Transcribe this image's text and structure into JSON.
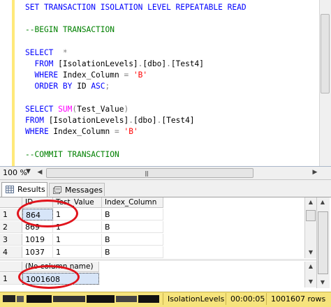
{
  "editor": {
    "lines": [
      {
        "parts": [
          {
            "t": "SET TRANSACTION ISOLATION LEVEL REPEATABLE READ",
            "c": "kw"
          }
        ]
      },
      {
        "parts": []
      },
      {
        "parts": [
          {
            "t": "--BEGIN TRANSACTION",
            "c": "cm"
          }
        ]
      },
      {
        "parts": []
      },
      {
        "parts": [
          {
            "t": "SELECT ",
            "c": "kw"
          },
          {
            "t": " *",
            "c": "gr"
          }
        ]
      },
      {
        "parts": [
          {
            "t": "  FROM ",
            "c": "kw"
          },
          {
            "t": "[IsolationLevels]",
            "c": "tx"
          },
          {
            "t": ".",
            "c": "gr"
          },
          {
            "t": "[dbo]",
            "c": "tx"
          },
          {
            "t": ".",
            "c": "gr"
          },
          {
            "t": "[Test4]",
            "c": "tx"
          }
        ]
      },
      {
        "parts": [
          {
            "t": "  WHERE ",
            "c": "kw"
          },
          {
            "t": "Index_Column ",
            "c": "tx"
          },
          {
            "t": "= ",
            "c": "gr"
          },
          {
            "t": "'B'",
            "c": "str"
          }
        ]
      },
      {
        "parts": [
          {
            "t": "  ORDER BY ",
            "c": "kw"
          },
          {
            "t": "ID ",
            "c": "tx"
          },
          {
            "t": "ASC",
            "c": "kw"
          },
          {
            "t": ";",
            "c": "gr"
          }
        ]
      },
      {
        "parts": []
      },
      {
        "parts": [
          {
            "t": "SELECT ",
            "c": "kw"
          },
          {
            "t": "SUM",
            "c": "fn"
          },
          {
            "t": "(",
            "c": "gr"
          },
          {
            "t": "Test_Value",
            "c": "tx"
          },
          {
            "t": ")",
            "c": "gr"
          }
        ]
      },
      {
        "parts": [
          {
            "t": "FROM ",
            "c": "kw"
          },
          {
            "t": "[IsolationLevels]",
            "c": "tx"
          },
          {
            "t": ".",
            "c": "gr"
          },
          {
            "t": "[dbo]",
            "c": "tx"
          },
          {
            "t": ".",
            "c": "gr"
          },
          {
            "t": "[Test4]",
            "c": "tx"
          }
        ]
      },
      {
        "parts": [
          {
            "t": "WHERE ",
            "c": "kw"
          },
          {
            "t": "Index_Column ",
            "c": "tx"
          },
          {
            "t": "= ",
            "c": "gr"
          },
          {
            "t": "'B'",
            "c": "str"
          }
        ]
      },
      {
        "parts": []
      },
      {
        "parts": [
          {
            "t": "--COMMIT TRANSACTION",
            "c": "cm"
          }
        ]
      }
    ]
  },
  "zoom": {
    "value": "100 %"
  },
  "tabs": {
    "results": "Results",
    "messages": "Messages"
  },
  "grid1": {
    "columns": [
      "ID",
      "Test_Value",
      "Index_Column"
    ],
    "rows": [
      {
        "num": "1",
        "id": "864",
        "val": "1",
        "idx": "B"
      },
      {
        "num": "2",
        "id": "869",
        "val": "1",
        "idx": "B"
      },
      {
        "num": "3",
        "id": "1019",
        "val": "1",
        "idx": "B"
      },
      {
        "num": "4",
        "id": "1037",
        "val": "1",
        "idx": "B"
      }
    ]
  },
  "grid2": {
    "columns": [
      "(No column name)"
    ],
    "rows": [
      {
        "num": "1",
        "value": "1001608"
      }
    ]
  },
  "status": {
    "database": "IsolationLevels",
    "elapsed": "00:00:05",
    "rows": "1001607 rows"
  },
  "colors": {
    "annotation": "#e1141c",
    "status_bg": "#f6e47c",
    "keyword": "#0000ff",
    "comment": "#008000",
    "string": "#ff0000"
  }
}
